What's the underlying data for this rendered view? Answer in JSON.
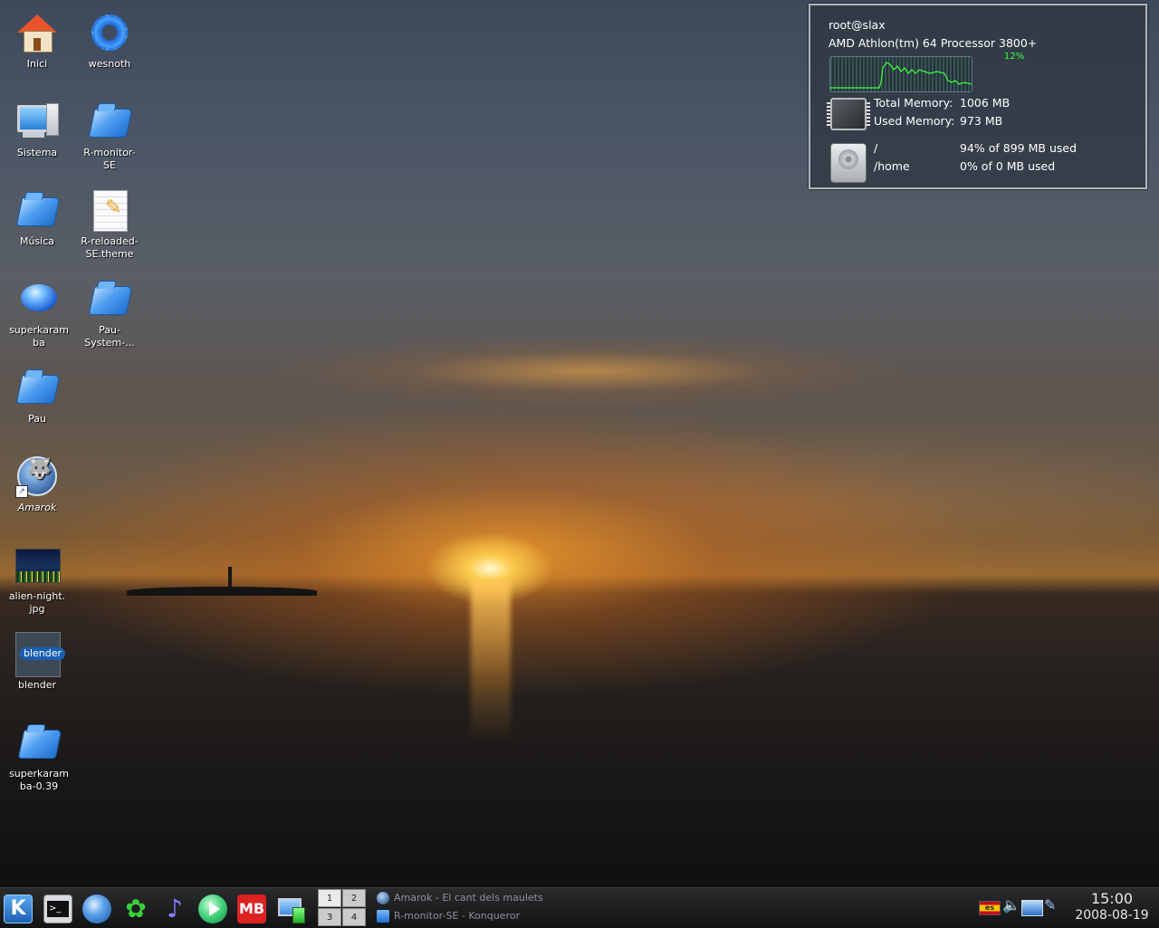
{
  "desktop_icons": [
    {
      "label": "Inici",
      "icon": "home-icon"
    },
    {
      "label": "wesnoth",
      "icon": "gear-icon"
    },
    {
      "label": "Sistema",
      "icon": "computer-icon"
    },
    {
      "label": "R-monitor-\nSE",
      "icon": "folder-icon"
    },
    {
      "label": "Música",
      "icon": "folder-icon"
    },
    {
      "label": "R-reloaded-\nSE.theme",
      "icon": "document-icon"
    },
    {
      "label": "superkaram\nba",
      "icon": "superkaramba-icon"
    },
    {
      "label": "Pau-\nSystem-...",
      "icon": "folder-icon"
    },
    {
      "label": "Pau",
      "icon": "folder-icon"
    },
    {
      "label": "Amarok",
      "icon": "amarok-icon"
    },
    {
      "label": "alien-night.\njpg",
      "icon": "image-thumbnail-icon"
    },
    {
      "label": "blender",
      "icon": "blender-icon"
    },
    {
      "label": "superkaram\nba-0.39",
      "icon": "folder-icon"
    }
  ],
  "sysmon": {
    "user": "root@slax",
    "cpu_name": "AMD Athlon(tm) 64 Processor 3800+",
    "cpu_usage": "12%",
    "cpu_usage_value": 12,
    "memory": {
      "total_label": "Total Memory:",
      "total_value": "1006 MB",
      "used_label": "Used Memory:",
      "used_value": "973 MB"
    },
    "disks": [
      {
        "mount": "/",
        "usage": "94% of 899 MB used"
      },
      {
        "mount": "/home",
        "usage": "0% of 0 MB used"
      }
    ],
    "colors": {
      "graph_line": "#3bff3b",
      "accent": "#3bff3b"
    }
  },
  "panel": {
    "launchers": [
      "kde-menu-icon",
      "konsole-icon",
      "konqueror-icon",
      "icq-icon",
      "music-icon",
      "media-player-icon",
      "mb-icon",
      "network-icon"
    ],
    "pager": [
      "1",
      "2",
      "3",
      "4"
    ],
    "tasks": [
      {
        "title": "Amarok - El cant dels maulets",
        "icon": "amarok-icon"
      },
      {
        "title": "R-monitor-SE - Konqueror",
        "icon": "folder-icon"
      }
    ],
    "tray": {
      "keyboard_layout": "es"
    },
    "clock": {
      "time": "15:00",
      "date": "2008-08-19"
    }
  }
}
